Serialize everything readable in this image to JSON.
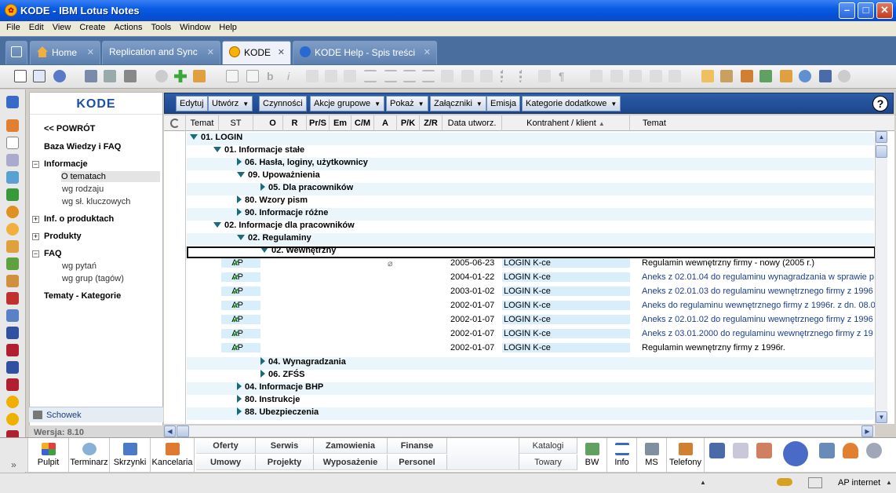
{
  "window": {
    "title": "KODE - IBM Lotus Notes"
  },
  "menu": [
    "File",
    "Edit",
    "View",
    "Create",
    "Actions",
    "Tools",
    "Window",
    "Help"
  ],
  "tabs": [
    {
      "label": "Home"
    },
    {
      "label": "Replication and Sync"
    },
    {
      "label": "KODE"
    },
    {
      "label": "KODE Help - Spis treści"
    }
  ],
  "nav": {
    "brand": "KODE",
    "back": "<< POWRÓT",
    "kb": "Baza Wiedzy i FAQ",
    "informacje": "Informacje",
    "o_tematach": "O tematach",
    "wg_rodzaju": "wg rodzaju",
    "wg_sl": "wg sł. kluczowych",
    "inf_prod": "Inf. o produktach",
    "produkty": "Produkty",
    "faq": "FAQ",
    "wg_pytan": "wg pytań",
    "wg_grup": "wg grup (tagów)",
    "tematy": "Tematy - Kategorie",
    "schowek": "Schowek",
    "wersja": "Wersja: 8.10"
  },
  "actions": [
    {
      "label": "Edytuj",
      "dd": false
    },
    {
      "label": "Utwórz",
      "dd": true
    },
    {
      "label": "Czynności",
      "dd": false
    },
    {
      "label": "Akcje grupowe",
      "dd": true
    },
    {
      "label": "Pokaż",
      "dd": true
    },
    {
      "label": "Załączniki",
      "dd": true
    },
    {
      "label": "Emisja",
      "dd": false
    },
    {
      "label": "Kategorie dodatkowe",
      "dd": true
    }
  ],
  "help_label": "?",
  "columns": [
    "Temat",
    "ST",
    "O",
    "R",
    "Pr/S",
    "Em",
    "C/M",
    "A",
    "P/K",
    "Z/R",
    "Data utworz.",
    "Kontrahent / klient",
    "Temat"
  ],
  "categories": [
    {
      "label": "01. LOGIN"
    },
    {
      "label": "01. Informacje stałe"
    },
    {
      "label": "06. Hasła, loginy, użytkownicy"
    },
    {
      "label": "09. Upoważnienia"
    },
    {
      "label": "05. Dla pracowników"
    },
    {
      "label": "80. Wzory pism"
    },
    {
      "label": "90. Informacje różne"
    },
    {
      "label": "02. Informacje dla pracowników"
    },
    {
      "label": "02. Regulaminy"
    },
    {
      "label": "02. Wewnętrzny"
    },
    {
      "label": "04. Wynagradzania"
    },
    {
      "label": "06. ZFŚS"
    },
    {
      "label": "04. Informacje BHP"
    },
    {
      "label": "80. Instrukcje"
    },
    {
      "label": "88. Ubezpieczenia"
    }
  ],
  "docs": [
    {
      "st": "AP",
      "date": "2005-06-23",
      "client": "LOGIN K-ce",
      "subject": "Regulamin wewnętrzny firmy - nowy (2005 r.)"
    },
    {
      "st": "AP",
      "date": "2004-01-22",
      "client": "LOGIN K-ce",
      "subject": "Aneks z 02.01.04 do regulaminu wynagradzania w sprawie p"
    },
    {
      "st": "AP",
      "date": "2003-01-02",
      "client": "LOGIN K-ce",
      "subject": "Aneks z 02.01.03 do regulaminu wewnętrznego firmy z 1996"
    },
    {
      "st": "AP",
      "date": "2002-01-07",
      "client": "LOGIN K-ce",
      "subject": "Aneks do regulaminu wewnętrznego firmy z 1996r. z dn. 08.0"
    },
    {
      "st": "AP",
      "date": "2002-01-07",
      "client": "LOGIN K-ce",
      "subject": "Aneks z 02.01.02 do regulaminu wewnętrznego firmy z 1996"
    },
    {
      "st": "AP",
      "date": "2002-01-07",
      "client": "LOGIN K-ce",
      "subject": "Aneks z 03.01.2000 do regulaminu wewnętrznego firmy z 19"
    },
    {
      "st": "AP",
      "date": "2002-01-07",
      "client": "LOGIN K-ce",
      "subject": "Regulamin wewnętrzny firmy z 1996r."
    }
  ],
  "bottom": {
    "pulpit": "Pulpit",
    "terminarz": "Terminarz",
    "skrzynki": "Skrzynki",
    "kancelaria": "Kancelaria",
    "oferty": "Oferty",
    "serwis": "Serwis",
    "zamowienia": "Zamowienia",
    "finanse": "Finanse",
    "umowy": "Umowy",
    "projekty": "Projekty",
    "wyposazenie": "Wyposażenie",
    "personel": "Personel",
    "katalogi": "Katalogi",
    "towary": "Towary",
    "bw": "BW",
    "info": "Info",
    "ms": "MS",
    "telefony": "Telefony",
    "more": "»"
  },
  "status": {
    "location": "AP internet"
  }
}
